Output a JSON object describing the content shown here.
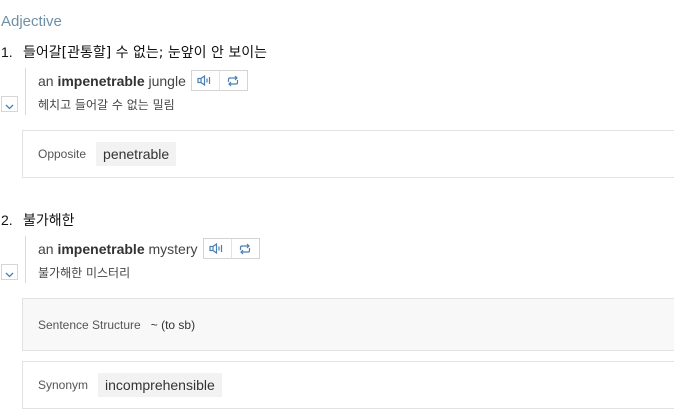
{
  "pos": "Adjective",
  "senses": [
    {
      "number": "1.",
      "definition": "들어갈[관통할] 수 없는; 눈앞이 안 보이는",
      "example": {
        "pre": "an ",
        "keyword": "impenetrable",
        "post": " jungle"
      },
      "translation": "헤치고 들어갈 수 없는 밀림",
      "opposite": {
        "label": "Opposite",
        "value": "penetrable"
      }
    },
    {
      "number": "2.",
      "definition": "불가해한",
      "example": {
        "pre": "an ",
        "keyword": "impenetrable",
        "post": " mystery"
      },
      "translation": "불가해한 미스터리",
      "structure": {
        "label": "Sentence Structure",
        "value": "~ (to sb)"
      },
      "synonym": {
        "label": "Synonym",
        "value": "incomprehensible"
      }
    }
  ],
  "icons": {
    "audio": "speaker-icon",
    "repeat": "repeat-icon",
    "expand": "chevron-down-icon"
  },
  "colors": {
    "pos_label": "#6f8fa6",
    "icon": "#4a7fb5",
    "chip_bg": "#f2f2f2"
  }
}
